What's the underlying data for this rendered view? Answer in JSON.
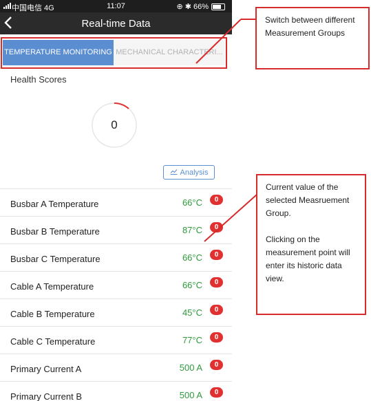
{
  "status_bar": {
    "carrier": "中国电信  4G",
    "time": "11:07",
    "indicators": "⊕ ✱ 66%",
    "battery_level": 0.66
  },
  "nav": {
    "back_icon": "chevron-left-icon",
    "title": "Real-time Data"
  },
  "tabs": [
    {
      "label": "TEMPERATURE MONITORING",
      "active": true
    },
    {
      "label": "MECHANICAL CHARACTERI...",
      "active": false
    }
  ],
  "health": {
    "label": "Health Scores",
    "score": "0"
  },
  "analysis": {
    "label": "Analysis",
    "icon": "trend-chart-icon"
  },
  "measurements": [
    {
      "name": "Busbar A Temperature",
      "value": "66°C",
      "badge": "0"
    },
    {
      "name": "Busbar B Temperature",
      "value": "87°C",
      "badge": "0"
    },
    {
      "name": "Busbar C Temperature",
      "value": "66°C",
      "badge": "0"
    },
    {
      "name": "Cable A Temperature",
      "value": "66°C",
      "badge": "0"
    },
    {
      "name": "Cable B Temperature",
      "value": "45°C",
      "badge": "0"
    },
    {
      "name": "Cable C Temperature",
      "value": "77°C",
      "badge": "0"
    },
    {
      "name": "Primary Current A",
      "value": "500 A",
      "badge": "0"
    },
    {
      "name": "Primary Current B",
      "value": "500 A",
      "badge": "0"
    }
  ],
  "annotations": {
    "switch_groups": "Switch between different Measurement Groups",
    "current_value": "Current value of the selected Measruement Group.\n\nClicking on the measurement point will enter its historic data view."
  },
  "colors": {
    "accent": "#5b8ed0",
    "value_green": "#2e9b3c",
    "badge_red": "#e03030",
    "annotation_red": "#d72b2b",
    "navbar": "#2b2b2b"
  }
}
